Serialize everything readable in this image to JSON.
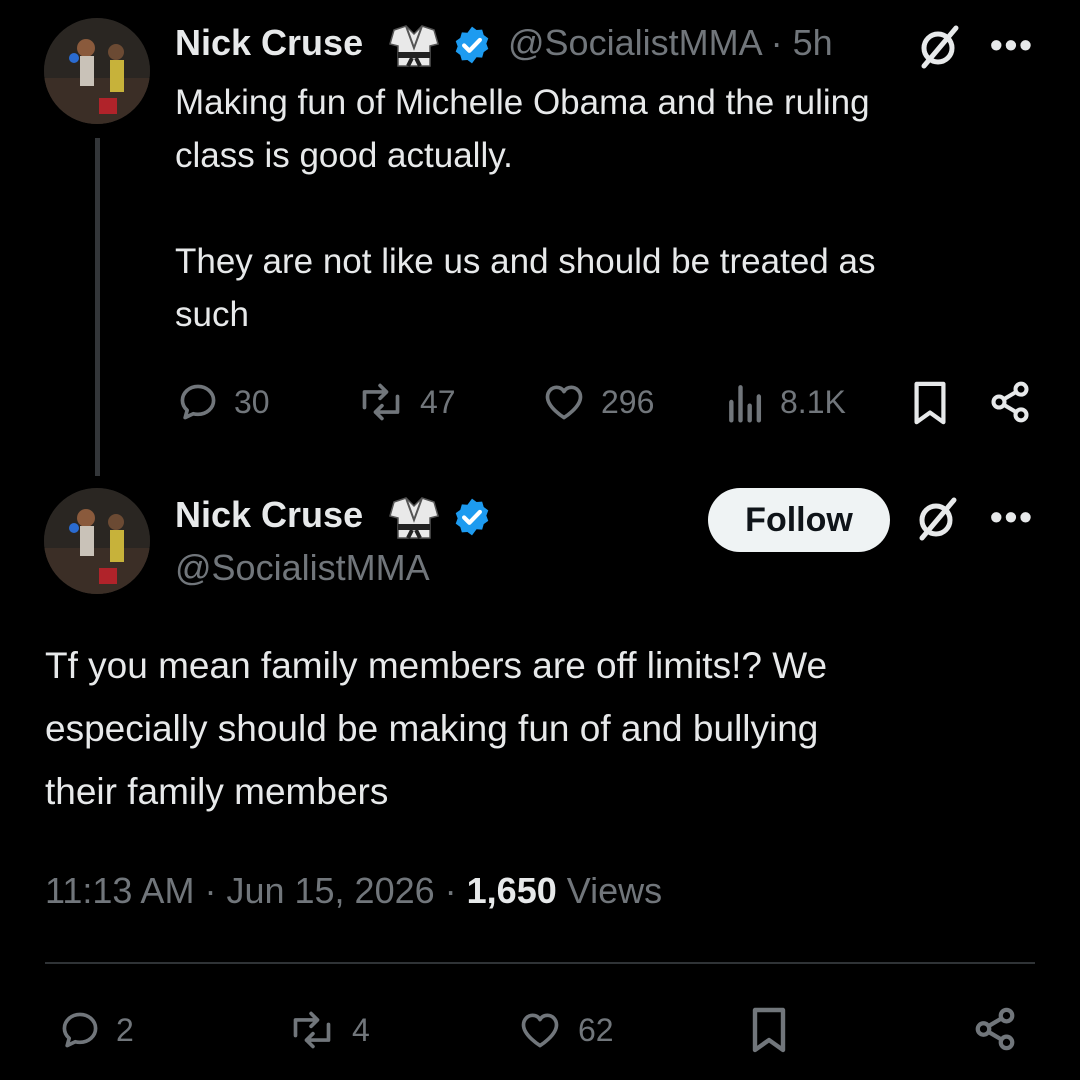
{
  "tweet1": {
    "author_name": "Nick Cruse",
    "author_handle": "@SocialistMMA",
    "separator": "·",
    "age": "5h",
    "text_line1": "Making fun of Michelle Obama and the ruling",
    "text_line2": "class is good actually.",
    "text_line3": "They are not like us and should be treated as",
    "text_line4": "such",
    "replies": "30",
    "reposts": "47",
    "likes": "296",
    "views": "8.1K"
  },
  "tweet2": {
    "author_name": "Nick Cruse",
    "author_handle": "@SocialistMMA",
    "follow_label": "Follow",
    "text_line1": "Tf you mean family members are off limits!? We",
    "text_line2": "especially should be making fun of and bullying",
    "text_line3": "their family members",
    "time": "11:13 AM",
    "date": "Jun 15, 2026",
    "views_count": "1,650",
    "views_label": "Views",
    "replies": "2",
    "reposts": "4",
    "likes": "62"
  },
  "menu_glyph": "•••",
  "colors": {
    "background": "#000000",
    "text": "#e7e9ea",
    "secondary": "#71767b",
    "verified": "#1d9bf0",
    "thread_line": "#333639"
  }
}
